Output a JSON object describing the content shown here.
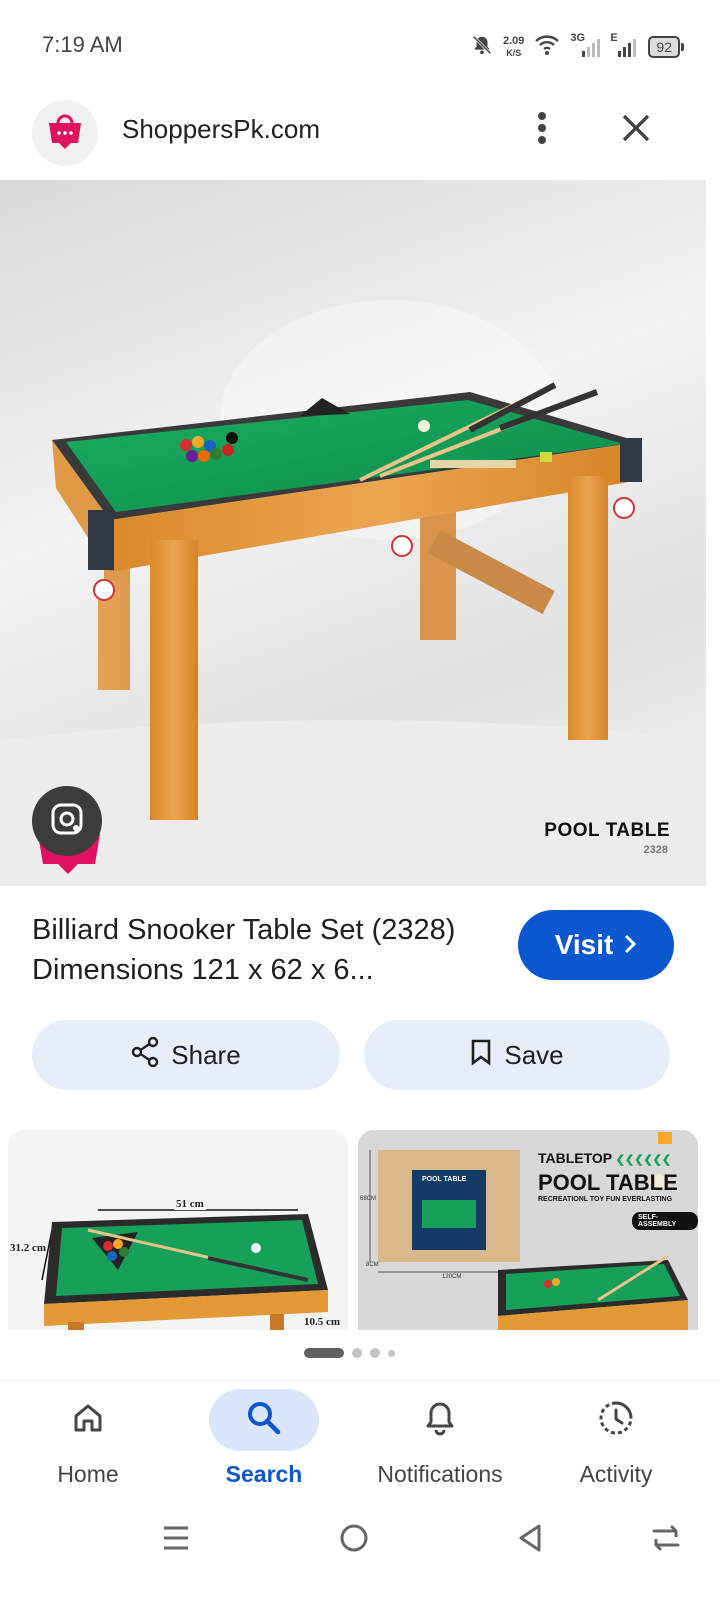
{
  "status_bar": {
    "time": "7:19 AM",
    "speed_value": "2.09",
    "speed_unit": "K/S",
    "net_3g": "3G",
    "net_e": "E",
    "battery": "92"
  },
  "header": {
    "site_name": "ShoppersPk.com",
    "logo_icon": "shopping-bag-icon"
  },
  "hero": {
    "caption": "POOL TABLE",
    "model_code": "2328"
  },
  "result": {
    "title": "Billiard Snooker Table Set (2328) Dimensions 121 x 62 x 6...",
    "visit_label": "Visit"
  },
  "actions": {
    "share_label": "Share",
    "save_label": "Save"
  },
  "thumbnails": [
    {
      "dim_top": "51 cm",
      "dim_left": "31.2 cm",
      "dim_bottom": "10.5 cm"
    },
    {
      "heading1": "TABLETOP",
      "heading2": "POOL TABLE",
      "subtitle": "RECREATIONL TOY FUN EVERLASTING",
      "badge": "SELF-ASSEMBLY",
      "box_text": "POOL TABLE",
      "dim_h": "68CM",
      "dim_w": "120CM",
      "dim_d": "8CM"
    }
  ],
  "bottom_nav": {
    "items": [
      {
        "label": "Home",
        "icon": "home-icon"
      },
      {
        "label": "Search",
        "icon": "search-icon",
        "active": true
      },
      {
        "label": "Notifications",
        "icon": "bell-icon"
      },
      {
        "label": "Activity",
        "icon": "activity-icon"
      }
    ]
  },
  "colors": {
    "accent": "#0b57d0",
    "chip_bg": "#e7eef9",
    "logo_pink": "#e0115f",
    "felt_green": "#16a05a",
    "wood": "#e39a36"
  }
}
